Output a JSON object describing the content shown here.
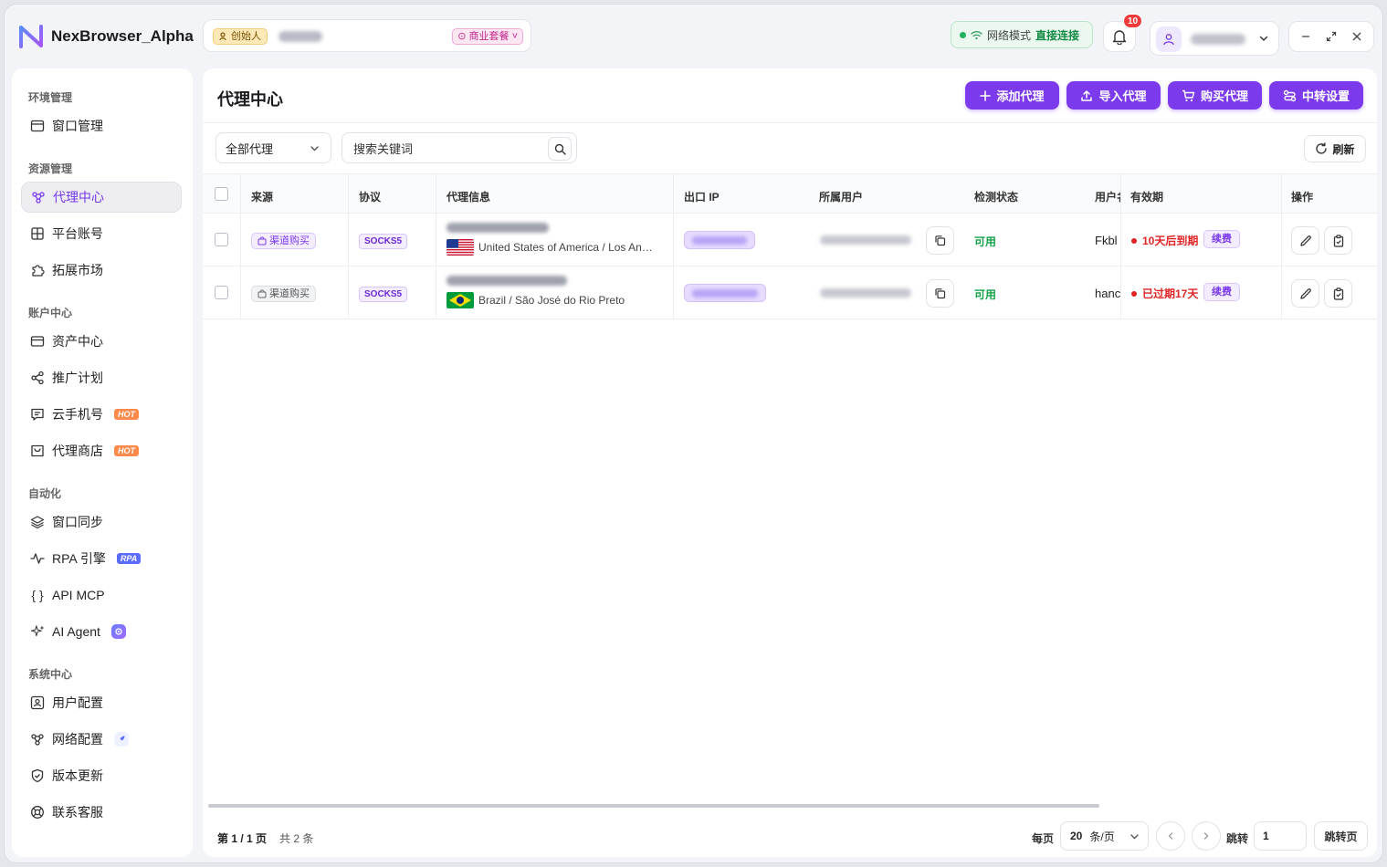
{
  "app": {
    "name": "NexBrowser_Alpha"
  },
  "workspace": {
    "role_badge": "创始人",
    "plan_badge": "商业套餐"
  },
  "network": {
    "label": "网络模式",
    "value": "直接连接"
  },
  "notifications": {
    "count": "10"
  },
  "sidebar": {
    "sections": [
      {
        "title": "环境管理",
        "items": [
          {
            "label": "窗口管理",
            "icon": "window-icon"
          }
        ]
      },
      {
        "title": "资源管理",
        "items": [
          {
            "label": "代理中心",
            "icon": "proxy-icon",
            "active": true
          },
          {
            "label": "平台账号",
            "icon": "grid-icon"
          },
          {
            "label": "拓展市场",
            "icon": "puzzle-icon"
          }
        ]
      },
      {
        "title": "账户中心",
        "items": [
          {
            "label": "资产中心",
            "icon": "card-icon"
          },
          {
            "label": "推广计划",
            "icon": "share-icon"
          },
          {
            "label": "云手机号",
            "icon": "message-icon",
            "badge": "HOT"
          },
          {
            "label": "代理商店",
            "icon": "store-icon",
            "badge": "HOT"
          }
        ]
      },
      {
        "title": "自动化",
        "items": [
          {
            "label": "窗口同步",
            "icon": "layers-icon"
          },
          {
            "label": "RPA 引擎",
            "icon": "pulse-icon",
            "badge": "RPA"
          },
          {
            "label": "API MCP",
            "icon": "braces-icon"
          },
          {
            "label": "AI Agent",
            "icon": "sparkle-icon"
          }
        ]
      },
      {
        "title": "系统中心",
        "items": [
          {
            "label": "用户配置",
            "icon": "user-config-icon"
          },
          {
            "label": "网络配置",
            "icon": "network-icon"
          },
          {
            "label": "版本更新",
            "icon": "shield-check-icon"
          },
          {
            "label": "联系客服",
            "icon": "lifebuoy-icon"
          }
        ]
      }
    ]
  },
  "main": {
    "title": "代理中心",
    "actions": [
      {
        "label": "添加代理",
        "icon": "plus-icon"
      },
      {
        "label": "导入代理",
        "icon": "upload-icon"
      },
      {
        "label": "购买代理",
        "icon": "cart-icon"
      },
      {
        "label": "中转设置",
        "icon": "relay-icon"
      }
    ],
    "filter": {
      "value": "全部代理"
    },
    "search": {
      "placeholder": "搜索关键词"
    },
    "refresh_label": "刷新"
  },
  "table": {
    "columns": [
      "来源",
      "协议",
      "代理信息",
      "出口 IP",
      "所属用户",
      "检测状态",
      "用户名",
      "有效期",
      "操作"
    ],
    "rows": [
      {
        "source": "渠道购买",
        "source_style": "purple",
        "protocol": "SOCKS5",
        "flag": "us",
        "location": "United States of America / Los Angeles",
        "status": "可用",
        "username": "Fkbl",
        "expiry": "10天后到期",
        "renew": "续费"
      },
      {
        "source": "渠道购买",
        "source_style": "gray",
        "protocol": "SOCKS5",
        "flag": "br",
        "location": "Brazil / São José do Rio Preto",
        "status": "可用",
        "username": "hanc",
        "expiry": "已过期17天",
        "renew": "续费"
      }
    ]
  },
  "pagination": {
    "page_info": "第 1 / 1 页",
    "total": "共 2 条",
    "per_page_label": "每页",
    "per_page_value": "20",
    "per_page_unit": "条/页",
    "jump_label": "跳转",
    "jump_value": "1",
    "jump_button": "跳转页"
  },
  "colors": {
    "accent": "#7c3aed",
    "success": "#16a34a",
    "danger": "#e02424",
    "hot": "#ff8a4c"
  }
}
